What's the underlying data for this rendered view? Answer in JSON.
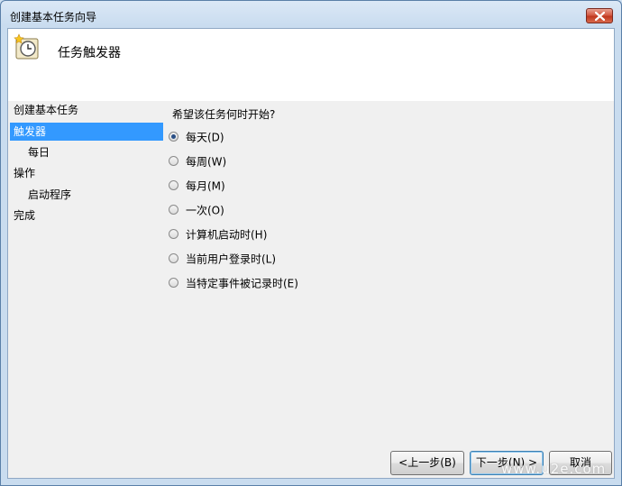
{
  "window": {
    "title": "创建基本任务向导"
  },
  "header": {
    "title": "任务触发器"
  },
  "nav": {
    "items": [
      {
        "label": "创建基本任务",
        "selected": false,
        "indent": false
      },
      {
        "label": "触发器",
        "selected": true,
        "indent": false
      },
      {
        "label": "每日",
        "selected": false,
        "indent": true
      },
      {
        "label": "操作",
        "selected": false,
        "indent": false
      },
      {
        "label": "启动程序",
        "selected": false,
        "indent": true
      },
      {
        "label": "完成",
        "selected": false,
        "indent": false
      }
    ]
  },
  "main": {
    "question": "希望该任务何时开始?",
    "options": [
      {
        "label": "每天(D)",
        "checked": true
      },
      {
        "label": "每周(W)",
        "checked": false
      },
      {
        "label": "每月(M)",
        "checked": false
      },
      {
        "label": "一次(O)",
        "checked": false
      },
      {
        "label": "计算机启动时(H)",
        "checked": false
      },
      {
        "label": "当前用户登录时(L)",
        "checked": false
      },
      {
        "label": "当特定事件被记录时(E)",
        "checked": false
      }
    ]
  },
  "buttons": {
    "back": "<上一步(B)",
    "next": "下一步(N) >",
    "cancel": "取消"
  },
  "watermark": "www.u2e.com"
}
